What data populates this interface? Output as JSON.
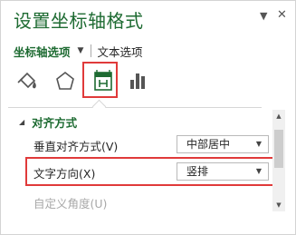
{
  "pane": {
    "title": "设置坐标轴格式",
    "dropdown_icon": "▼",
    "close_icon": "✕"
  },
  "options": {
    "active": "坐标轴选项",
    "caret": "▼",
    "other": "文本选项"
  },
  "icons": [
    "fill-line-icon",
    "effects-pentagon-icon",
    "size-properties-icon",
    "axis-options-icon"
  ],
  "section": {
    "toggle": "◢",
    "title": "对齐方式"
  },
  "rows": {
    "vertical_align": {
      "label": "垂直对齐方式(V)",
      "value": "中部居中"
    },
    "text_direction": {
      "label": "文字方向(X)",
      "value": "竖排"
    },
    "custom_angle": {
      "label": "自定义角度(U)"
    }
  },
  "dropdown_arrow": "▼",
  "scroll": {
    "up": "▲",
    "down": "▼"
  },
  "colors": {
    "accent": "#1e6b32",
    "highlight": "#e03a3a"
  }
}
